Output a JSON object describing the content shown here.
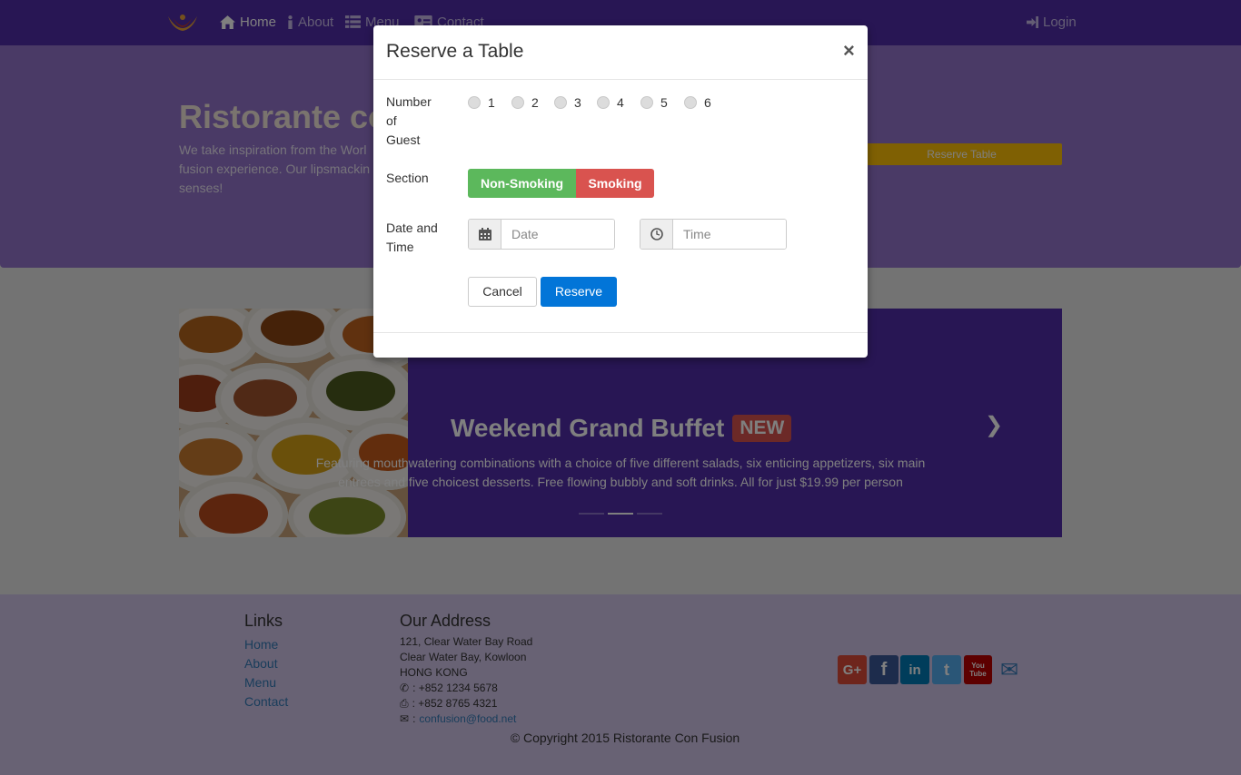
{
  "navbar": {
    "items": [
      {
        "label": "Home",
        "icon": "home-icon"
      },
      {
        "label": "About",
        "icon": "info-icon"
      },
      {
        "label": "Menu",
        "icon": "list-icon"
      },
      {
        "label": "Contact",
        "icon": "address-card-icon"
      }
    ],
    "login": {
      "label": "Login",
      "icon": "sign-in-icon"
    }
  },
  "jumbotron": {
    "title": "Ristorante co",
    "text": "We take inspiration from the Worl fusion experience. Our lipsmackin senses!",
    "reserve_label": "Reserve Table"
  },
  "carousel": {
    "title": "Weekend Grand Buffet",
    "badge": "NEW",
    "caption": "Featuring mouthwatering combinations with a choice of five different salads, six enticing appetizers, six main entrees and five choicest desserts. Free flowing bubbly and soft drinks. All for just $19.99 per person",
    "active_slide": 2,
    "slide_count": 3
  },
  "modal": {
    "title": "Reserve a Table",
    "close": "×",
    "guests_label": [
      "Number",
      "of",
      "Guest"
    ],
    "guest_options": [
      "1",
      "2",
      "3",
      "4",
      "5",
      "6"
    ],
    "section_label": "Section",
    "section_options": [
      "Non-Smoking",
      "Smoking"
    ],
    "datetime_label": [
      "Date and",
      "Time"
    ],
    "date_placeholder": "Date",
    "time_placeholder": "Time",
    "cancel_label": "Cancel",
    "reserve_label": "Reserve"
  },
  "footer": {
    "links_heading": "Links",
    "links": [
      "Home",
      "About",
      "Menu",
      "Contact"
    ],
    "address_heading": "Our Address",
    "address_lines": [
      "121, Clear Water Bay Road",
      "Clear Water Bay, Kowloon",
      "HONG KONG"
    ],
    "phone": ": +852 1234 5678",
    "fax": ": +852 8765 4321",
    "email": "confusion@food.net",
    "email_prefix": ":",
    "copyright": "© Copyright 2015 Ristorante Con Fusion",
    "social": [
      {
        "label": "G+",
        "color": "#dd4b39",
        "icon": "google-plus-icon"
      },
      {
        "label": "f",
        "color": "#3b5998",
        "icon": "facebook-icon"
      },
      {
        "label": "in",
        "color": "#007bb6",
        "icon": "linkedin-icon"
      },
      {
        "label": "t",
        "color": "#55acee",
        "icon": "twitter-icon"
      },
      {
        "label": "You Tube",
        "color": "#bb0000",
        "icon": "youtube-icon"
      },
      {
        "label": "✉",
        "color": "#337ab7",
        "icon": "envelope-icon"
      }
    ]
  }
}
